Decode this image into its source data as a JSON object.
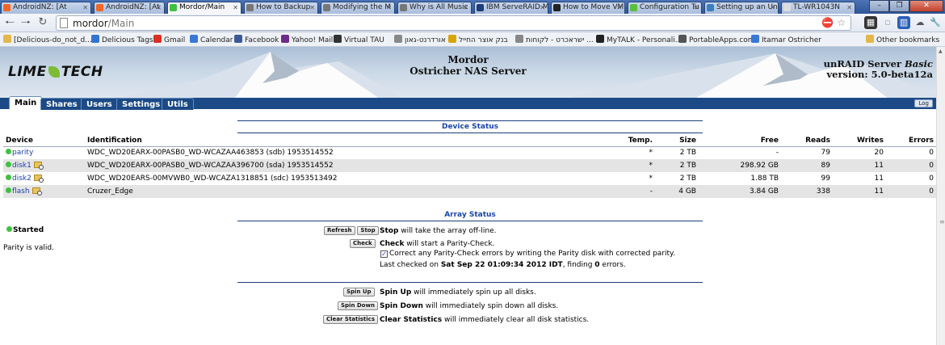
{
  "browser": {
    "tabs": [
      {
        "label": "AndroidNZ: [At",
        "icon_color": "#f26522"
      },
      {
        "label": "AndroidNZ: [At",
        "icon_color": "#f26522"
      },
      {
        "label": "Mordor/Main",
        "icon_color": "#3ec13e"
      },
      {
        "label": "How to Backup",
        "icon_color": "#777777"
      },
      {
        "label": "Modifying the M",
        "icon_color": "#777777"
      },
      {
        "label": "Why is All Music",
        "icon_color": "#777777"
      },
      {
        "label": "IBM ServeRAID M",
        "icon_color": "#1f3b7a"
      },
      {
        "label": "How to Move VM",
        "icon_color": "#222222"
      },
      {
        "label": "Configuration Tu",
        "icon_color": "#5bbf3a"
      },
      {
        "label": "Setting up an Un",
        "icon_color": "#3a7fc0"
      },
      {
        "label": "TL-WR1043N",
        "icon_color": "#dddddd"
      }
    ],
    "url_host": "mordor",
    "url_path": "/Main",
    "bookmarks": [
      {
        "label": "[Delicious-do_not_d...",
        "icon_color": "#e5b64a"
      },
      {
        "label": "Delicious Tags",
        "icon_color": "#3274d1"
      },
      {
        "label": "Gmail",
        "icon_color": "#d93025"
      },
      {
        "label": "Calendar",
        "icon_color": "#3a78d8"
      },
      {
        "label": "Facebook",
        "icon_color": "#3b5998"
      },
      {
        "label": "Yahoo! Mail",
        "icon_color": "#6e2a8c"
      },
      {
        "label": "Virtual TAU",
        "icon_color": "#333333"
      },
      {
        "label": "אורדרנט-גאון",
        "icon_color": "#888888"
      },
      {
        "label": "בנק אוצר החייל",
        "icon_color": "#d9a400"
      },
      {
        "label": "ישראכרט - לקוחות ...",
        "icon_color": "#888888"
      },
      {
        "label": "MyTALK - Personali...",
        "icon_color": "#222222"
      },
      {
        "label": "PortableApps.com",
        "icon_color": "#555555"
      },
      {
        "label": "Itamar Ostricher",
        "icon_color": "#3a78d8"
      }
    ],
    "other_bookmarks": "Other bookmarks"
  },
  "header": {
    "logo_left": "LIME",
    "logo_right": "TECH",
    "server_name": "Mordor",
    "server_desc": "Ostricher NAS Server",
    "version_line1": "unRAID Server",
    "version_edition": "Basic",
    "version_line2": "version: 5.0-beta12a"
  },
  "nav": {
    "tabs": [
      "Main",
      "Shares",
      "Users",
      "Settings",
      "Utils"
    ],
    "active": "Main",
    "log_label": "Log"
  },
  "device_status": {
    "title": "Device Status",
    "columns": [
      "Device",
      "Identification",
      "Temp.",
      "Size",
      "Free",
      "Reads",
      "Writes",
      "Errors"
    ],
    "rows": [
      {
        "device": "parity",
        "id": "WDC_WD20EARX-00PASB0_WD-WCAZAA463853 (sdb) 1953514552",
        "temp": "*",
        "size": "2 TB",
        "free": "-",
        "reads": "79",
        "writes": "20",
        "errors": "0",
        "browse": false
      },
      {
        "device": "disk1",
        "id": "WDC_WD20EARX-00PASB0_WD-WCAZAA396700 (sda) 1953514552",
        "temp": "*",
        "size": "2 TB",
        "free": "298.92 GB",
        "reads": "89",
        "writes": "11",
        "errors": "0",
        "browse": true
      },
      {
        "device": "disk2",
        "id": "WDC_WD20EARS-00MVWB0_WD-WCAZA1318851 (sdc) 1953513492",
        "temp": "*",
        "size": "2 TB",
        "free": "1.88 TB",
        "reads": "99",
        "writes": "11",
        "errors": "0",
        "browse": true
      },
      {
        "device": "flash",
        "id": "Cruzer_Edge",
        "temp": "-",
        "size": "4 GB",
        "free": "3.84 GB",
        "reads": "338",
        "writes": "11",
        "errors": "0",
        "browse": true
      }
    ]
  },
  "array_status": {
    "title": "Array Status",
    "state": "Started",
    "parity_msg": "Parity is valid.",
    "refresh_label": "Refresh",
    "stop_label": "Stop",
    "stop_bold": "Stop",
    "stop_text": " will take the array off-line.",
    "check_label": "Check",
    "check_bold": "Check",
    "check_text": " will start a Parity-Check.",
    "correct_text": "Correct any Parity-Check errors by writing the Parity disk with corrected parity.",
    "last_checked_prefix": "Last checked on ",
    "last_checked_date": "Sat Sep 22 01:09:34 2012 IDT",
    "last_checked_mid": ", finding ",
    "last_checked_errors": "0",
    "last_checked_suffix": " errors.",
    "spinup_label": "Spin Up",
    "spinup_bold": "Spin Up",
    "spinup_text": " will immediately spin up all disks.",
    "spindown_label": "Spin Down",
    "spindown_bold": "Spin Down",
    "spindown_text": " will immediately spin down all disks.",
    "clear_label": "Clear Statistics",
    "clear_bold": "Clear Statistics",
    "clear_text": " will immediately clear all disk statistics."
  }
}
